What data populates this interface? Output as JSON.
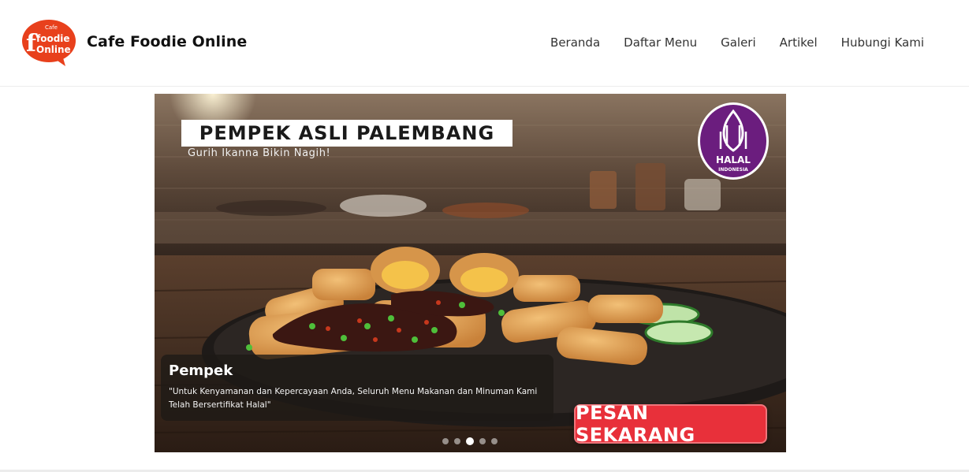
{
  "brand": {
    "name": "Cafe Foodie Online",
    "logo_text_small": "Cafe",
    "logo_text_1": "foodie",
    "logo_text_2": "Online"
  },
  "nav": {
    "items": [
      {
        "label": "Beranda"
      },
      {
        "label": "Daftar Menu"
      },
      {
        "label": "Galeri"
      },
      {
        "label": "Artikel"
      },
      {
        "label": "Hubungi Kami"
      }
    ]
  },
  "slider": {
    "banner_title": "PEMPEK ASLI PALEMBANG",
    "banner_subtitle": "Gurih Ikanna Bikin Nagih!",
    "halal_label": "HALAL",
    "halal_sublabel": "INDONESIA",
    "caption_title": "Pempek",
    "caption_text": "\"Untuk Kenyamanan dan Kepercayaan Anda, Seluruh Menu Makanan dan Minuman Kami Telah Bersertifikat Halal\"",
    "order_button": "PESAN SEKARANG",
    "slide_count": 5,
    "active_slide": 3
  },
  "colors": {
    "logo_red": "#e8401c",
    "halal_purple": "#6b1d7e",
    "order_red": "#e8303a"
  },
  "icons": {
    "logo": "speech-bubble-logo",
    "halal": "halal-indonesia-seal"
  }
}
